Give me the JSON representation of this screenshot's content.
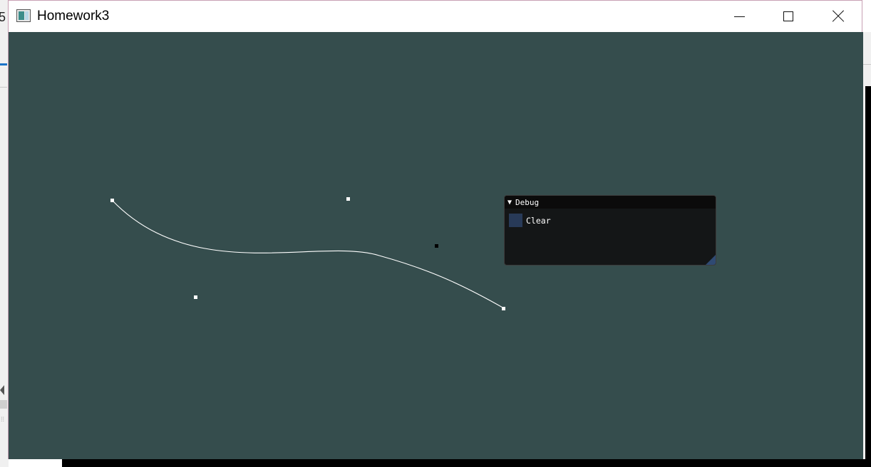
{
  "window": {
    "title": "Homework3",
    "caption_buttons": [
      "minimize",
      "maximize",
      "close"
    ]
  },
  "background": {
    "left_fragment_text": "5"
  },
  "canvas": {
    "background_color": "#354d4d",
    "curve_color": "#ffffff",
    "point_color": "#ffffff",
    "selected_point_color": "#000000"
  },
  "debug_panel": {
    "title": "Debug",
    "collapse_symbol": "▼",
    "checkbox_label": "Clear",
    "swatch_color": "#283a58"
  }
}
